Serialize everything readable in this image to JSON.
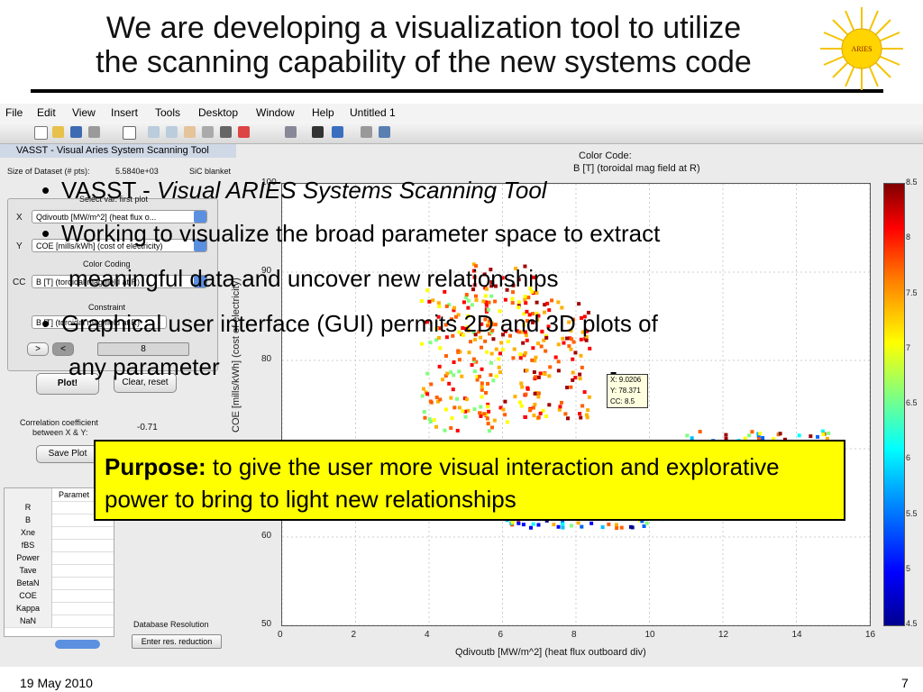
{
  "slide": {
    "title_line1": "We are developing a visualization tool to utilize",
    "title_line2": "the scanning capability of the new systems code",
    "logo_text": "ARIES",
    "footer_date": "19 May 2010",
    "footer_page": "7"
  },
  "menubar": [
    "File",
    "Edit",
    "View",
    "Insert",
    "Tools",
    "Desktop",
    "Window",
    "Help",
    "Untitled 1"
  ],
  "gui": {
    "title": "VASST - Visual Aries System Scanning Tool",
    "dataset_label": "Size of Dataset (# pts):",
    "dataset_value": "5.5840e+03",
    "blanket": "SiC blanket",
    "select_label": "Select var. first plot",
    "x_label": "X",
    "x_value": "Qdivoutb [MW/m^2] (heat flux o...",
    "y_label": "Y",
    "y_value": "COE [mills/kWh] (cost of electricity)",
    "cc_section": "Color Coding",
    "cc_label": "CC",
    "cc_value": "B [T] (toroidal mag field at R)",
    "constraint_section": "Constraint",
    "constraint_value": "B [T] (toroidal mag field at R)",
    "next_btn": ">",
    "prev_btn": "<",
    "slider_value": "8",
    "plot_btn": "Plot!",
    "clear_btn": "Clear, reset",
    "corr_label1": "Correlation coefficient",
    "corr_label2": "between X & Y:",
    "corr_value": "-0.71",
    "save_btn": "Save Plot",
    "param_header": "Paramet",
    "params": [
      "R",
      "B",
      "Xne",
      "fBS",
      "Power",
      "Tave",
      "BetaN",
      "COE",
      "Kappa",
      "NaN"
    ],
    "db_res_label": "Database Resolution",
    "db_res_btn": "Enter res. reduction"
  },
  "plot": {
    "cc_title": "Color Code:",
    "cc_subtitle": "B [T] (toroidal mag field at R)",
    "xlabel": "Qdivoutb [MW/m^2] (heat flux outboard div)",
    "ylabel": "COE [mills/kWh] (cost of electricity)",
    "datatip_x": "X: 9.0206",
    "datatip_y": "Y: 78.371",
    "datatip_cc": "CC: 8.5"
  },
  "chart_data": {
    "type": "scatter",
    "xlabel": "Qdivoutb [MW/m^2] (heat flux outboard div)",
    "ylabel": "COE [mills/kWh] (cost of electricity)",
    "xlim": [
      0,
      16
    ],
    "ylim": [
      50,
      100
    ],
    "xticks": [
      "0",
      "2",
      "4",
      "6",
      "8",
      "10",
      "12",
      "14",
      "16"
    ],
    "yticks": [
      "50",
      "60",
      "70",
      "80",
      "90",
      "100"
    ],
    "colorbar_ticks": [
      "4.5",
      "5",
      "5.5",
      "6",
      "6.5",
      "7",
      "7.5",
      "8",
      "8.5"
    ],
    "colorbar_label": "B [T] (toroidal mag field at R)",
    "grid": true,
    "highlight_point": {
      "x": 9.0206,
      "y": 78.371,
      "cc": 8.5
    }
  },
  "bullets": {
    "b1_prefix": "VASST - ",
    "b1_italic": "Visual ARIES Systems Scanning Tool",
    "b2_line1": "Working to visualize the broad parameter space to extract",
    "b2_line2": "meaningful data and uncover new relationships",
    "b3_line1": "Graphical user interface (GUI) permits 2D and 3D plots of",
    "b3_line2": "any parameter"
  },
  "purpose": {
    "label": "Purpose:",
    "text": " to give the user more visual interaction and explorative power to bring to light new relationships"
  },
  "colors": {
    "purpose_bg": "#ffff00",
    "accent_blue": "#5b8fe0"
  }
}
